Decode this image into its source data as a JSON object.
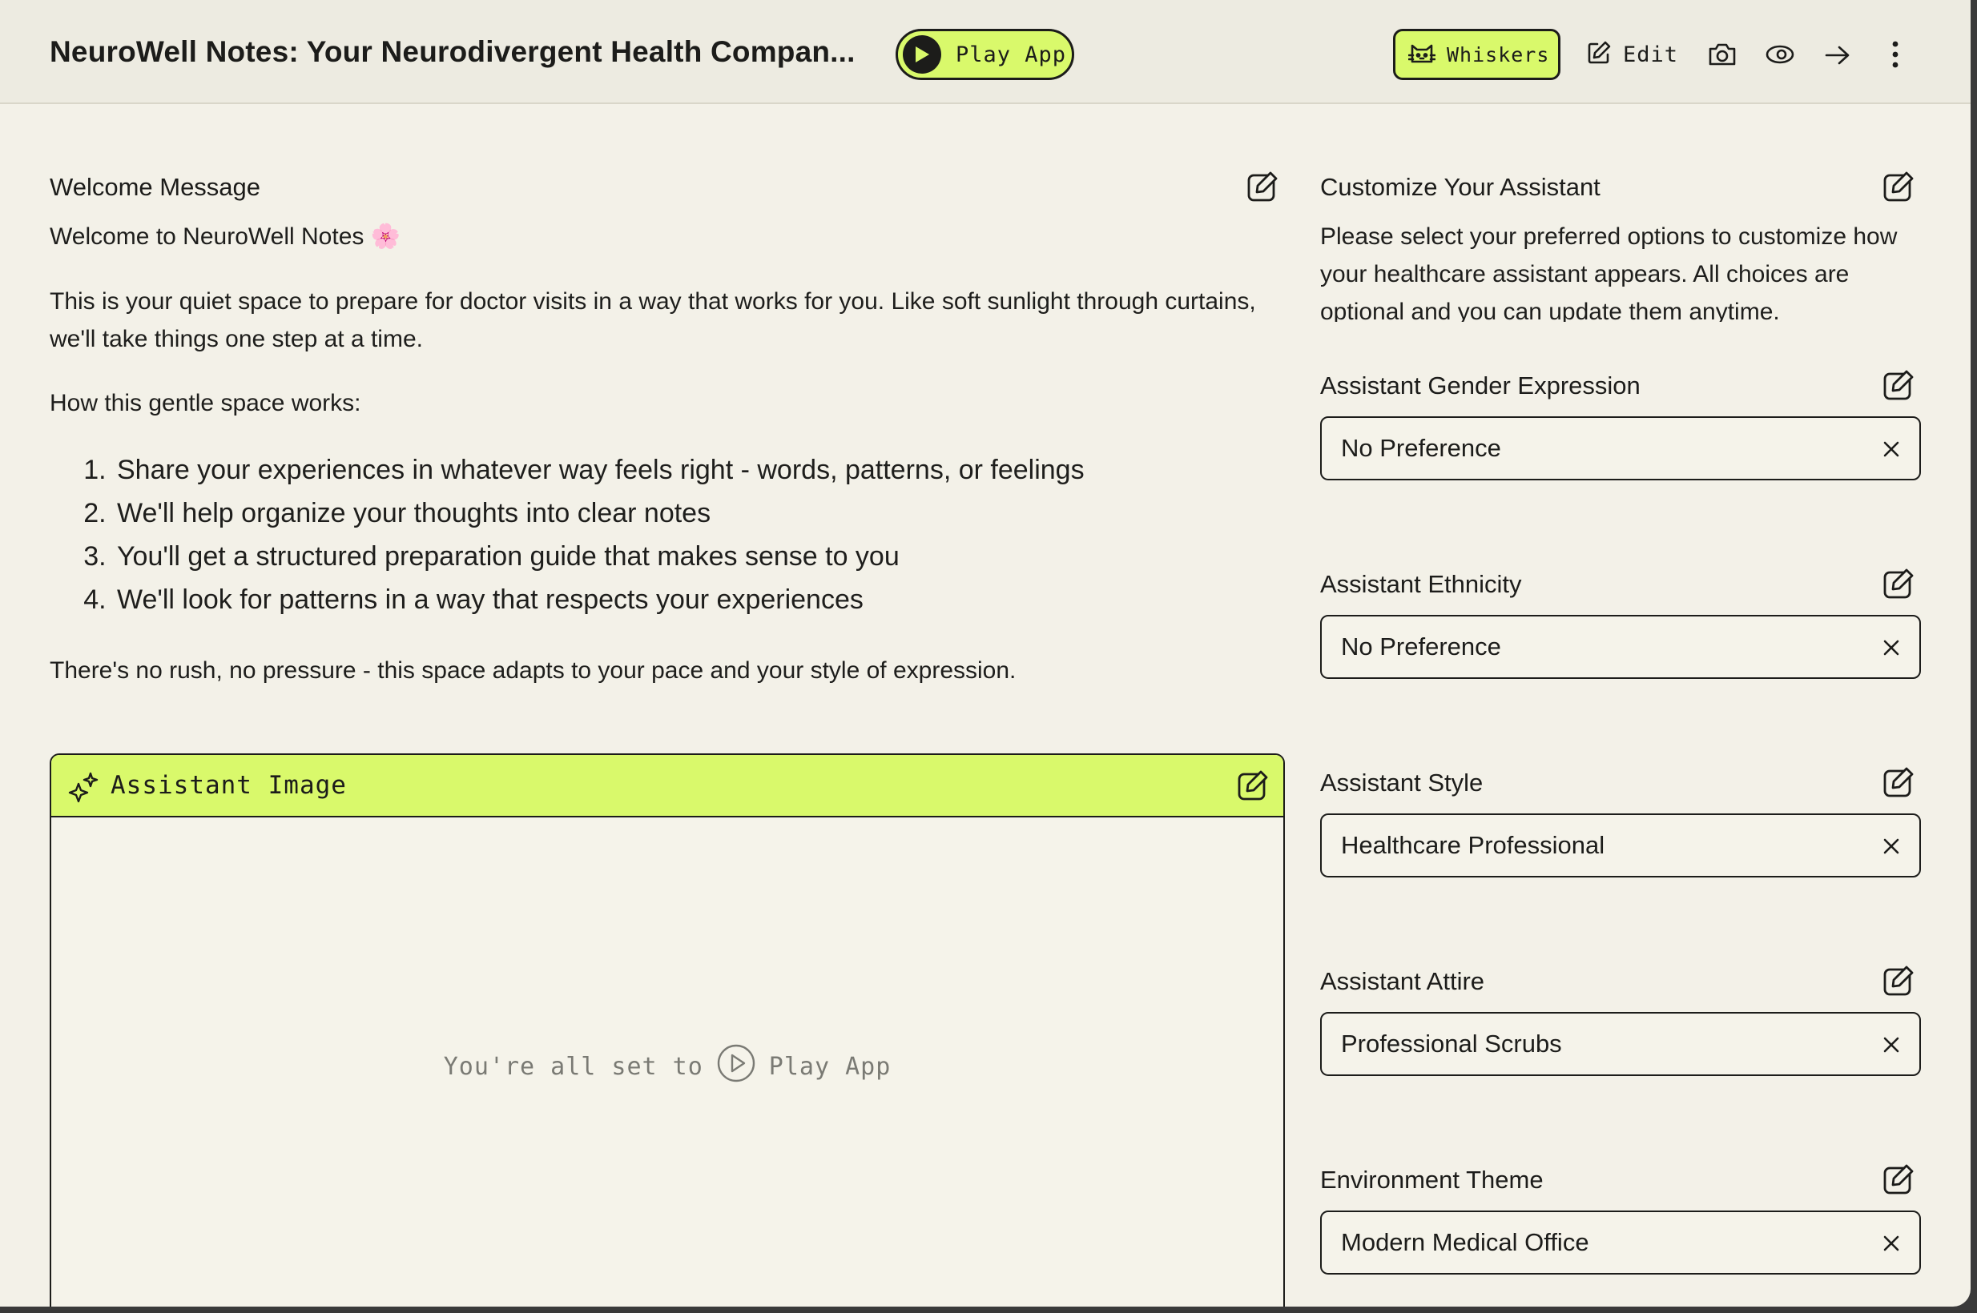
{
  "header": {
    "title": "NeuroWell Notes: Your Neurodivergent Health Compan...",
    "play_label": "Play App",
    "whiskers_label": "Whiskers",
    "edit_label": "Edit"
  },
  "welcome": {
    "heading": "Welcome Message",
    "greeting": "Welcome to NeuroWell Notes 🌸",
    "intro": "This is your quiet space to prepare for doctor visits in a way that works for you. Like soft sunlight through curtains, we'll take things one step at a time.",
    "how_label": "How this gentle space works:",
    "steps": [
      "Share your experiences in whatever way feels right - words, patterns, or feelings",
      "We'll help organize your thoughts into clear notes",
      "You'll get a structured preparation guide that makes sense to you",
      "We'll look for patterns in a way that respects your experiences"
    ],
    "closing": "There's no rush, no pressure - this space adapts to your pace and your style of expression."
  },
  "image_panel": {
    "heading": "Assistant Image",
    "status_prefix": "You're all set to",
    "status_action": "Play App"
  },
  "customize": {
    "heading": "Customize Your Assistant",
    "intro": "Please select your preferred options to customize how your healthcare assistant appears. All choices are optional and you can update them anytime.",
    "fields": [
      {
        "label": "Assistant Gender Expression",
        "value": "No Preference"
      },
      {
        "label": "Assistant Ethnicity",
        "value": "No Preference"
      },
      {
        "label": "Assistant Style",
        "value": "Healthcare Professional"
      },
      {
        "label": "Assistant Attire",
        "value": "Professional Scrubs"
      },
      {
        "label": "Environment Theme",
        "value": "Modern Medical Office"
      }
    ]
  },
  "colors": {
    "accent": "#d9f96b",
    "background": "#f3f1e8",
    "header_background": "#edebe1",
    "text": "#1c1c1a"
  },
  "icons": {
    "play": "play-icon",
    "whiskers": "cat-icon",
    "edit": "pencil-icon",
    "camera": "camera-icon",
    "visibility": "eye-icon",
    "share": "arrow-right-icon",
    "menu": "more-vertical-icon",
    "sparkle": "sparkle-icon",
    "clear": "close-icon"
  }
}
